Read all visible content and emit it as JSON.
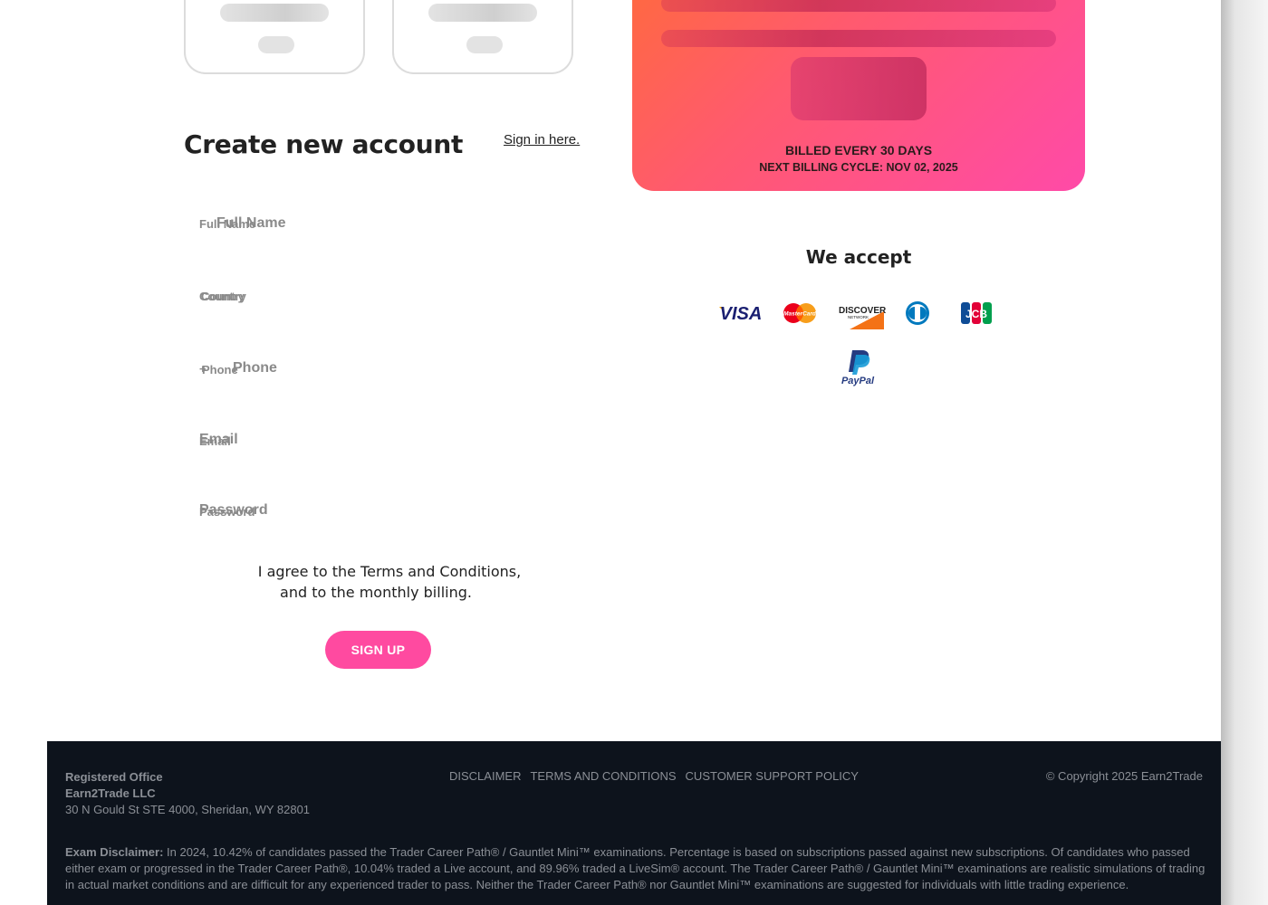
{
  "form": {
    "title": "Create new account",
    "signin_link": "Sign in here.",
    "fields": {
      "full_name": {
        "label_small": "Full Name",
        "label_big": "Full Name"
      },
      "country": {
        "label_small": "Country",
        "label_big": "Country"
      },
      "phone": {
        "label_small": "Phone",
        "label_big": "Phone",
        "prefix": "+"
      },
      "email": {
        "label_small": "Email",
        "label_big": "Email"
      },
      "password": {
        "label_small": "Password",
        "label_big": "Password"
      }
    },
    "agree_line1": "I agree to the Terms and Conditions,",
    "agree_line2": "and to the monthly billing.",
    "signup_button": "SIGN UP"
  },
  "plan": {
    "billed": "BILLED EVERY 30 DAYS",
    "next_cycle": "NEXT BILLING CYCLE: NOV 02, 2025"
  },
  "payments": {
    "heading": "We accept",
    "methods": [
      "VISA",
      "MasterCard",
      "DISCOVER",
      "Diners Club",
      "JCB",
      "PayPal"
    ],
    "visa_text": "VISA",
    "discover_text": "DISCOVER",
    "discover_sub": "NETWORK",
    "mastercard_text": "MasterCard",
    "jcb_text": "JCB",
    "paypal_text": "PayPal"
  },
  "footer": {
    "office_title": "Registered Office",
    "office_company": "Earn2Trade LLC",
    "office_address": "30 N Gould St STE 4000, Sheridan, WY 82801",
    "links": [
      "DISCLAIMER",
      "TERMS AND CONDITIONS",
      "CUSTOMER SUPPORT POLICY"
    ],
    "copyright": "© Copyright 2025 Earn2Trade",
    "disclaimer_label": "Exam Disclaimer:",
    "disclaimer_text": "In 2024, 10.42% of candidates passed the Trader Career Path® / Gauntlet Mini™ examinations. Percentage is based on subscriptions passed against new subscriptions. Of candidates who passed either exam or progressed in the Trader Career Path®, 10.04% traded a Live account, and 89.96% traded a LiveSim® account. The Trader Career Path® / Gauntlet Mini™ examinations are realistic simulations of trading in actual market conditions and are difficult for any experienced trader to pass. Neither the Trader Career Path® nor Gauntlet Mini™ examinations are suggested for individuals with little trading experience."
  },
  "colors": {
    "accent": "#ff4aa0",
    "plan_gradient_start": "#ff6a3d",
    "plan_gradient_end": "#ff4aa8",
    "footer_bg": "#0d131c"
  }
}
